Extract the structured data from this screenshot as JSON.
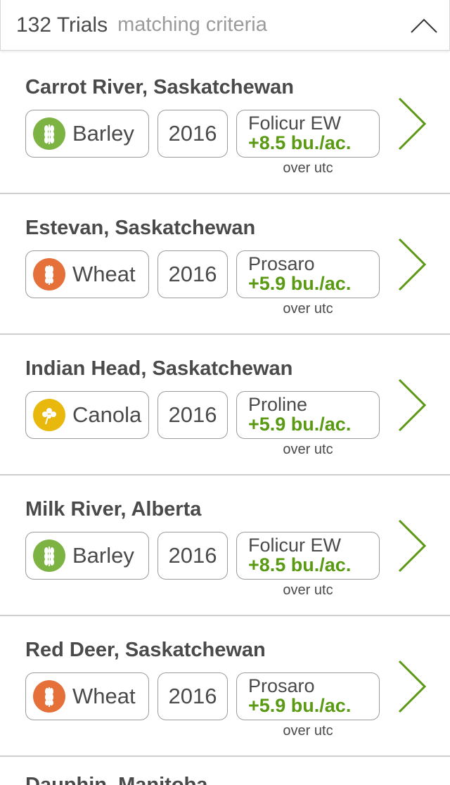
{
  "header": {
    "count_label": "132 Trials",
    "subtitle": "matching criteria"
  },
  "colors": {
    "accent_green": "#5a9a12",
    "barley": "#7cb342",
    "wheat": "#e5703a",
    "canola": "#e8b80c",
    "border": "#9b9b9b",
    "text": "#4a4a4a"
  },
  "trials": [
    {
      "location": "Carrot River, Saskatchewan",
      "crop": "Barley",
      "crop_icon": "barley-icon",
      "year": "2016",
      "product": "Folicur EW",
      "gain": "+8.5 bu./ac.",
      "note": "over utc"
    },
    {
      "location": "Estevan, Saskatchewan",
      "crop": "Wheat",
      "crop_icon": "wheat-icon",
      "year": "2016",
      "product": "Prosaro",
      "gain": "+5.9 bu./ac.",
      "note": "over utc"
    },
    {
      "location": "Indian Head, Saskatchewan",
      "crop": "Canola",
      "crop_icon": "canola-icon",
      "year": "2016",
      "product": "Proline",
      "gain": "+5.9 bu./ac.",
      "note": "over utc"
    },
    {
      "location": "Milk River, Alberta",
      "crop": "Barley",
      "crop_icon": "barley-icon",
      "year": "2016",
      "product": "Folicur EW",
      "gain": "+8.5 bu./ac.",
      "note": "over utc"
    },
    {
      "location": "Red Deer, Saskatchewan",
      "crop": "Wheat",
      "crop_icon": "wheat-icon",
      "year": "2016",
      "product": "Prosaro",
      "gain": "+5.9 bu./ac.",
      "note": "over utc"
    }
  ],
  "partial_next_location": "Dauphin, Manitoba"
}
